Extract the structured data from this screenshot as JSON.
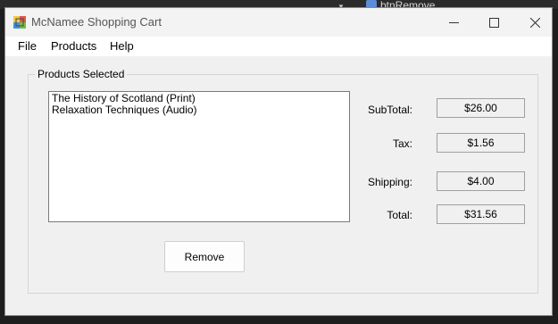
{
  "background": {
    "tab_label": "btnRemove"
  },
  "window": {
    "title": "McNamee Shopping Cart",
    "controls": {
      "minimize": "minimize-icon",
      "maximize": "maximize-icon",
      "close": "close-icon"
    }
  },
  "menu": {
    "items": [
      {
        "label": "File"
      },
      {
        "label": "Products"
      },
      {
        "label": "Help"
      }
    ]
  },
  "products_group": {
    "label": "Products Selected",
    "items": [
      "The History of Scotland (Print)",
      "Relaxation Techniques (Audio)"
    ],
    "remove_button": "Remove"
  },
  "totals": {
    "subtotal_label": "SubTotal:",
    "subtotal_value": "$26.00",
    "tax_label": "Tax:",
    "tax_value": "$1.56",
    "shipping_label": "Shipping:",
    "shipping_value": "$4.00",
    "total_label": "Total:",
    "total_value": "$31.56"
  }
}
